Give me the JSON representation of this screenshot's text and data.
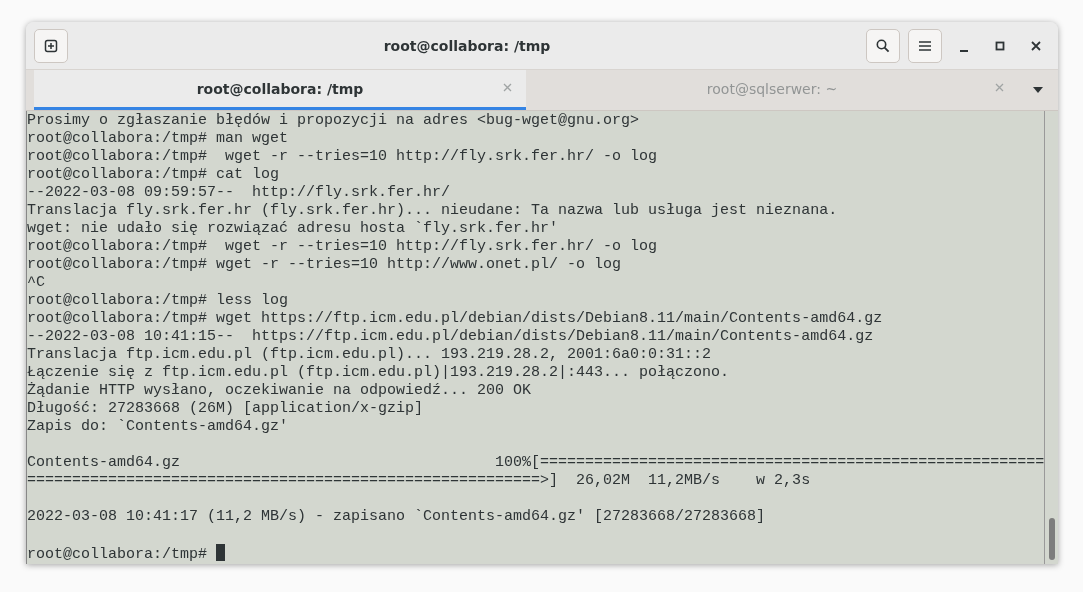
{
  "window": {
    "title": "root@collabora: /tmp"
  },
  "tabs": [
    {
      "label": "root@collabora: /tmp",
      "selected": true
    },
    {
      "label": "root@sqlserwer: ~",
      "selected": false
    }
  ],
  "terminal": {
    "blocks": [
      [
        "Prosimy o zgłaszanie błędów i propozycji na adres <bug-wget@gnu.org>",
        "root@collabora:/tmp# man wget",
        "root@collabora:/tmp#  wget -r --tries=10 http://fly.srk.fer.hr/ -o log",
        "root@collabora:/tmp# cat log",
        "--2022-03-08 09:59:57--  http://fly.srk.fer.hr/",
        "Translacja fly.srk.fer.hr (fly.srk.fer.hr)... nieudane: Ta nazwa lub usługa jest nieznana.",
        "wget: nie udało się rozwiązać adresu hosta `fly.srk.fer.hr'",
        "root@collabora:/tmp#  wget -r --tries=10 http://fly.srk.fer.hr/ -o log",
        "root@collabora:/tmp# wget -r --tries=10 http://www.onet.pl/ -o log",
        "^C",
        "root@collabora:/tmp# less log",
        "root@collabora:/tmp# wget https://ftp.icm.edu.pl/debian/dists/Debian8.11/main/Contents-amd64.gz",
        "--2022-03-08 10:41:15--  https://ftp.icm.edu.pl/debian/dists/Debian8.11/main/Contents-amd64.gz",
        "Translacja ftp.icm.edu.pl (ftp.icm.edu.pl)... 193.219.28.2, 2001:6a0:0:31::2",
        "Łączenie się z ftp.icm.edu.pl (ftp.icm.edu.pl)|193.219.28.2|:443... połączono.",
        "Żądanie HTTP wysłano, oczekiwanie na odpowiedź... 200 OK",
        "Długość: 27283668 (26M) [application/x-gzip]",
        "Zapis do: `Contents-amd64.gz'"
      ],
      [
        "Contents-amd64.gz                                   100%[========================================================",
        "=========================================================>]  26,02M  11,2MB/s    w 2,3s"
      ],
      [
        "2022-03-08 10:41:17 (11,2 MB/s) - zapisano `Contents-amd64.gz' [27283668/27283668]"
      ]
    ],
    "prompt": "root@collabora:/tmp# "
  }
}
